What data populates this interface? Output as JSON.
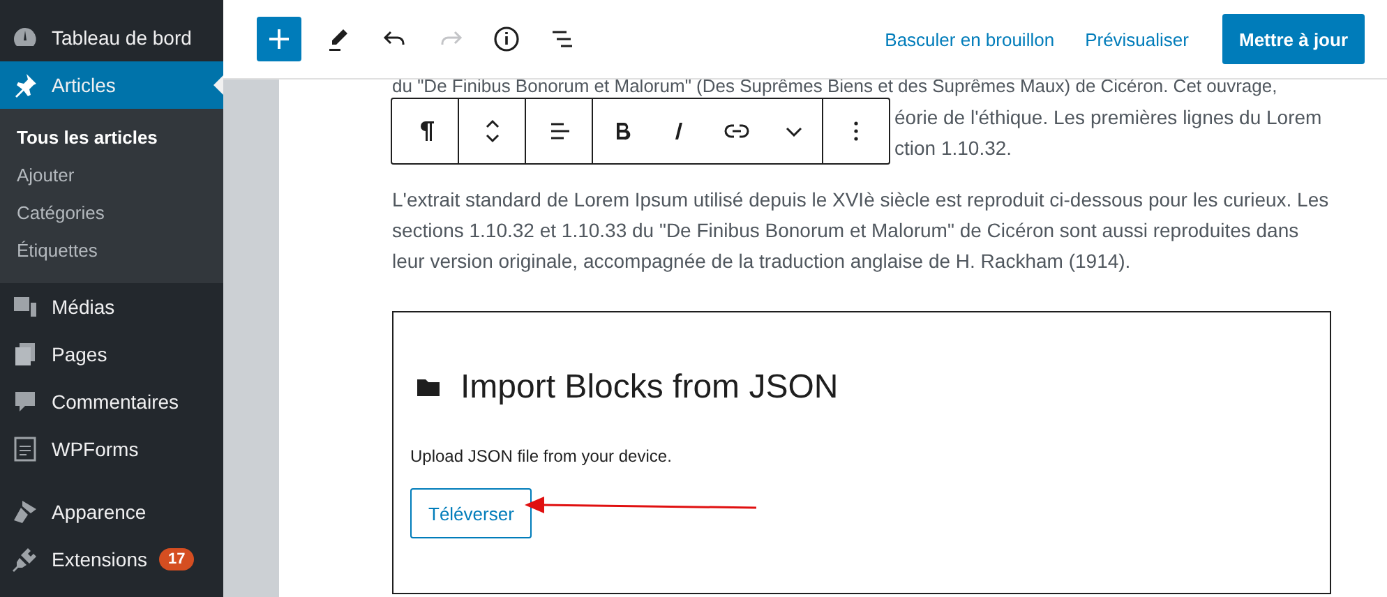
{
  "sidebar": {
    "items": [
      {
        "label": "Tableau de bord",
        "selected": false
      },
      {
        "label": "Articles",
        "selected": true,
        "children": [
          {
            "label": "Tous les articles",
            "selected": true
          },
          {
            "label": "Ajouter",
            "selected": false
          },
          {
            "label": "Catégories",
            "selected": false
          },
          {
            "label": "Étiquettes",
            "selected": false
          }
        ]
      },
      {
        "label": "Médias",
        "selected": false
      },
      {
        "label": "Pages",
        "selected": false
      },
      {
        "label": "Commentaires",
        "selected": false
      },
      {
        "label": "WPForms",
        "selected": false
      },
      {
        "label": "Apparence",
        "selected": false
      },
      {
        "label": "Extensions",
        "selected": false,
        "badge": "17"
      }
    ]
  },
  "toolbar": {
    "tools": [
      {
        "disabled": false
      },
      {
        "disabled": false
      },
      {
        "disabled": true
      },
      {
        "disabled": false
      },
      {
        "disabled": false
      }
    ],
    "links": [
      "Basculer en brouillon",
      "Prévisualiser"
    ],
    "primary": "Mettre à jour"
  },
  "content": {
    "partial_lines": [
      "du \"De Finibus Bonorum et Malorum\" (Des Suprêmes Biens et des Suprêmes Maux) de Cicéron. Cet ouvrage,",
      "éorie de l'éthique. Les premières lignes du Lorem",
      "ction 1.10.32."
    ],
    "paragraph": "L'extrait standard de Lorem Ipsum utilisé depuis le XVIè siècle est reproduit ci-dessous pour les curieux. Les sections 1.10.32 et 1.10.33 du \"De Finibus Bonorum et Malorum\" de Cicéron sont aussi reproduites dans leur version originale, accompagnée de la traduction anglaise de H. Rackham (1914).",
    "import_block": {
      "title": "Import Blocks from JSON",
      "description": "Upload JSON file from your device.",
      "button": "Téléverser"
    }
  }
}
